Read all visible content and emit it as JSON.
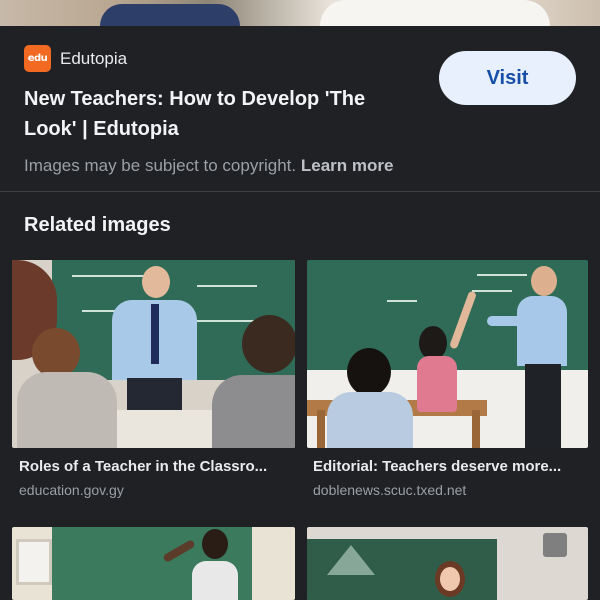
{
  "source": {
    "favicon_text": "edu",
    "name": "Edutopia",
    "brand_color": "#f26a21"
  },
  "visit_label": "Visit",
  "title": "New Teachers: How to Develop 'The Look' | Edutopia",
  "copyright": {
    "text": "Images may be subject to copyright.",
    "link": "Learn more"
  },
  "related_heading": "Related images",
  "related": [
    {
      "caption": "Roles of a Teacher in the Classro...",
      "source": "education.gov.gy"
    },
    {
      "caption": "Editorial: Teachers deserve more...",
      "source": "doblenews.scuc.txed.net"
    }
  ],
  "colors": {
    "background": "#202124",
    "visit_bg": "#e8f0fe",
    "visit_text": "#174ea6",
    "chalkboard": "#2f6b57"
  }
}
